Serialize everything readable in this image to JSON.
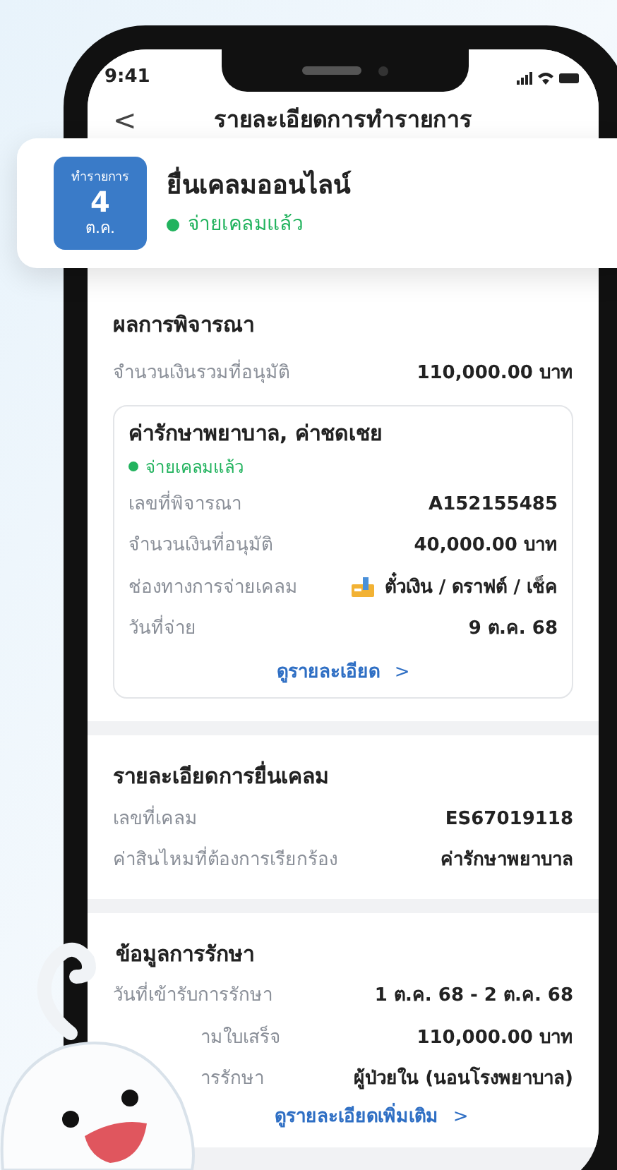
{
  "status_bar": {
    "time": "9:41"
  },
  "header": {
    "back": "<",
    "title": "รายละเอียดการทำรายการ"
  },
  "summary": {
    "date_caption": "ทำรายการ",
    "day": "4",
    "month": "ต.ค.",
    "title": "ยื่นเคลมออนไลน์",
    "status": "จ่ายเคลมแล้ว"
  },
  "result": {
    "heading": "ผลการพิจารณา",
    "total_label": "จำนวนเงินรวมที่อนุมัติ",
    "total_value": "110,000.00 บาท",
    "claim": {
      "title": "ค่ารักษาพยาบาล, ค่าชดเชย",
      "status": "จ่ายเคลมแล้ว",
      "rows": [
        {
          "label": "เลขที่พิจารณา",
          "value": "A152155485",
          "icon": false
        },
        {
          "label": "จำนวนเงินที่อนุมัติ",
          "value": "40,000.00 บาท",
          "icon": false
        },
        {
          "label": "ช่องทางการจ่ายเคลม",
          "value": "ตั๋วเงิน / ดราฟต์ / เช็ค",
          "icon": true
        },
        {
          "label": "วันที่จ่าย",
          "value": "9 ต.ค. 68",
          "icon": false
        }
      ],
      "link": "ดูรายละเอียด",
      "link_chevron": ">"
    }
  },
  "claim_details": {
    "heading": "รายละเอียดการยื่นเคลม",
    "rows": [
      {
        "label": "เลขที่เคลม",
        "value": "ES67019118"
      },
      {
        "label": "ค่าสินไหมที่ต้องการเรียกร้อง",
        "value": "ค่ารักษาพยาบาล"
      }
    ]
  },
  "treatment": {
    "heading": "ข้อมูลการรักษา",
    "rows": [
      {
        "label": "วันที่เข้ารับการรักษา",
        "value": "1 ต.ค. 68 - 2 ต.ค. 68"
      },
      {
        "label": "ามใบเสร็จ",
        "value": "110,000.00 บาท"
      },
      {
        "label": "ารรักษา",
        "value": "ผู้ป่วยใน (นอนโรงพยาบาล)"
      }
    ],
    "link": "ดูรายละเอียดเพิ่มเติม",
    "link_chevron": ">"
  }
}
